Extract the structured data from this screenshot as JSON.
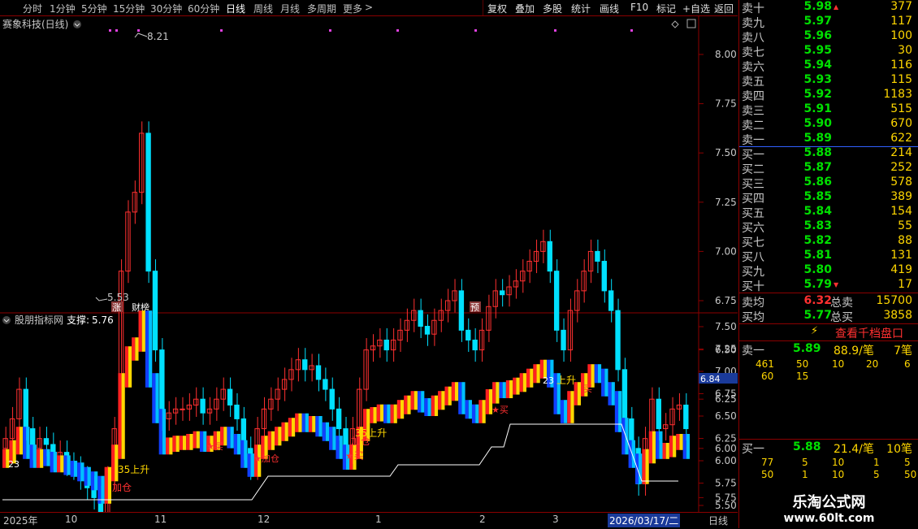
{
  "toolbar": {
    "timeframes": [
      "分时",
      "1分钟",
      "5分钟",
      "15分钟",
      "30分钟",
      "60分钟",
      "日线",
      "周线",
      "月线",
      "多周期",
      "更多"
    ],
    "active": "日线",
    "buttons": [
      "复权",
      "叠加",
      "多股",
      "统计",
      "画线",
      "F10",
      "标记",
      "+自选",
      "返回"
    ],
    "more_arrow": ">"
  },
  "main_chart": {
    "title": "赛象科技(日线)",
    "high_label": "8.21",
    "low_label": "5.53",
    "price_ticks": [
      "8.00",
      "7.75",
      "7.50",
      "7.25",
      "7.00",
      "6.75",
      "6.50",
      "6.25",
      "6.00",
      "5.75",
      "5.50"
    ],
    "markers": [
      "涨",
      "财榜",
      "预"
    ]
  },
  "indicator": {
    "title": "股朋指标网",
    "support_label": "支撑:",
    "support_value": "5.76",
    "price_ticks": [
      "7.50",
      "7.25",
      "7.00",
      "6.75",
      "6.50",
      "6.25",
      "6.00",
      "5.75",
      "5.50"
    ],
    "current_tag": "6.84",
    "labels": [
      "23",
      "35上升",
      "加仓",
      "35上升",
      "加仓",
      "★买",
      "23",
      "上升",
      "★买",
      "★买",
      "★加仓",
      "买"
    ]
  },
  "date_axis": {
    "labels": [
      "2025年",
      "10",
      "11",
      "12",
      "1",
      "2",
      "3"
    ],
    "cursor": "2026/03/17/二",
    "period": "日线"
  },
  "quote": {
    "asks": [
      {
        "label": "卖十",
        "price": "5.98",
        "volume": "377",
        "arrow": "up"
      },
      {
        "label": "卖九",
        "price": "5.97",
        "volume": "117"
      },
      {
        "label": "卖八",
        "price": "5.96",
        "volume": "100"
      },
      {
        "label": "卖七",
        "price": "5.95",
        "volume": "30"
      },
      {
        "label": "卖六",
        "price": "5.94",
        "volume": "116"
      },
      {
        "label": "卖五",
        "price": "5.93",
        "volume": "115"
      },
      {
        "label": "卖四",
        "price": "5.92",
        "volume": "1183"
      },
      {
        "label": "卖三",
        "price": "5.91",
        "volume": "515"
      },
      {
        "label": "卖二",
        "price": "5.90",
        "volume": "670"
      },
      {
        "label": "卖一",
        "price": "5.89",
        "volume": "622"
      }
    ],
    "bids": [
      {
        "label": "买一",
        "price": "5.88",
        "volume": "214"
      },
      {
        "label": "买二",
        "price": "5.87",
        "volume": "252"
      },
      {
        "label": "买三",
        "price": "5.86",
        "volume": "578"
      },
      {
        "label": "买四",
        "price": "5.85",
        "volume": "389"
      },
      {
        "label": "买五",
        "price": "5.84",
        "volume": "154"
      },
      {
        "label": "买六",
        "price": "5.83",
        "volume": "55"
      },
      {
        "label": "买七",
        "price": "5.82",
        "volume": "88"
      },
      {
        "label": "买八",
        "price": "5.81",
        "volume": "131"
      },
      {
        "label": "买九",
        "price": "5.80",
        "volume": "419"
      },
      {
        "label": "买十",
        "price": "5.79",
        "volume": "17",
        "arrow": "down"
      }
    ],
    "avg_sell": {
      "label": "卖均",
      "price": "6.32",
      "total_label": "总卖",
      "total": "15700"
    },
    "avg_buy": {
      "label": "买均",
      "price": "5.77",
      "total_label": "总买",
      "total": "3858"
    },
    "view_thousand": "查看千档盘口",
    "sell1": {
      "label": "卖一",
      "price": "5.89",
      "avg": "88.9/笔",
      "count": "7笔",
      "orders": [
        "461",
        "50",
        "10",
        "20",
        "6",
        "60",
        "15"
      ]
    },
    "buy1": {
      "label": "买一",
      "price": "5.88",
      "avg": "21.4/笔",
      "count": "10笔",
      "orders": [
        "77",
        "5",
        "10",
        "1",
        "5",
        "50",
        "1",
        "10",
        "5",
        "50"
      ]
    },
    "watermark_title": "乐淘公式网",
    "watermark_url": "www.60lt.com"
  },
  "colors": {
    "up": "#ff3030",
    "down": "#00e0ff",
    "bid_bar": "#1040ff",
    "ask_bar": "#ff2020",
    "yellow": "#ffd700",
    "green": "#00e000"
  }
}
